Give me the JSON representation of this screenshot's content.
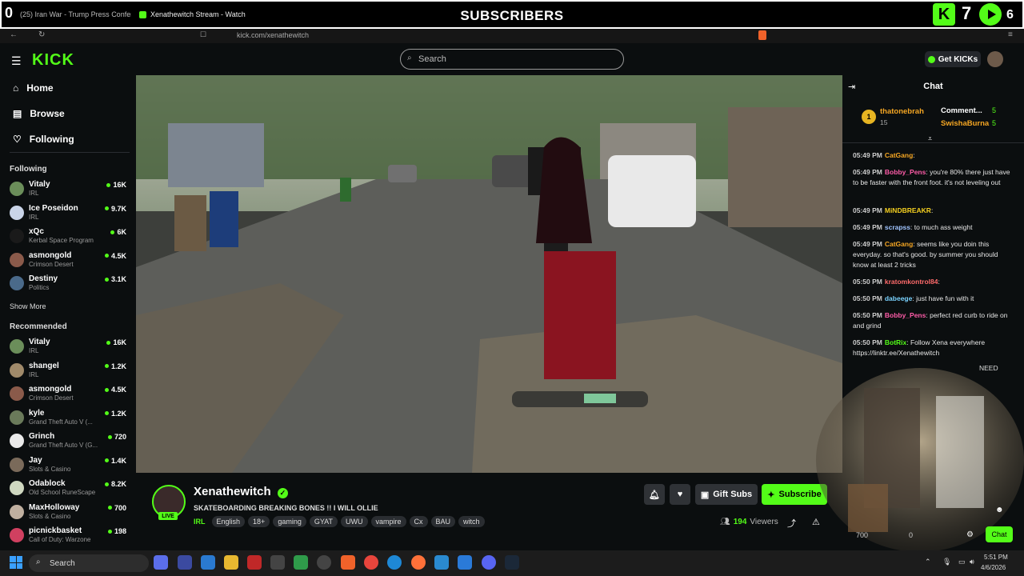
{
  "overlay": {
    "title": "SUBSCRIBERS",
    "left_count": "0",
    "right_count_a": "7",
    "right_count_b": "6"
  },
  "browser": {
    "tabs": [
      "(25) Iran War - Trump Press Conferen",
      "Xenathewitch Stream - Watch"
    ],
    "url": "kick.com/xenathewitch"
  },
  "header": {
    "logo": "KICK",
    "search_placeholder": "Search",
    "get_kicks_label": "Get KICKs"
  },
  "sidebar": {
    "nav": [
      "Home",
      "Browse",
      "Following"
    ],
    "following_title": "Following",
    "following": [
      {
        "name": "Vitaly",
        "category": "IRL",
        "viewers": "16K",
        "color": "#6b8e5a"
      },
      {
        "name": "Ice Poseidon",
        "category": "IRL",
        "viewers": "9.7K",
        "color": "#c9d4e8"
      },
      {
        "name": "xQc",
        "category": "Kerbal Space Program",
        "viewers": "6K",
        "color": "#1a1a1a"
      },
      {
        "name": "asmongold",
        "category": "Crimson Desert",
        "viewers": "4.5K",
        "color": "#8a5a4a"
      },
      {
        "name": "Destiny",
        "category": "Politics",
        "viewers": "3.1K",
        "color": "#4a6a8a"
      }
    ],
    "show_more": "Show More",
    "recommended_title": "Recommended",
    "recommended": [
      {
        "name": "Vitaly",
        "category": "IRL",
        "viewers": "16K",
        "color": "#6b8e5a"
      },
      {
        "name": "shangel",
        "category": "IRL",
        "viewers": "1.2K",
        "color": "#a08a6a"
      },
      {
        "name": "asmongold",
        "category": "Crimson Desert",
        "viewers": "4.5K",
        "color": "#8a5a4a"
      },
      {
        "name": "kyle",
        "category": "Grand Theft Auto V (...",
        "viewers": "1.2K",
        "color": "#6a7a5a"
      },
      {
        "name": "Grinch",
        "category": "Grand Theft Auto V (G...",
        "viewers": "720",
        "color": "#eaeaea"
      },
      {
        "name": "Jay",
        "category": "Slots & Casino",
        "viewers": "1.4K",
        "color": "#7a6a5a"
      },
      {
        "name": "Odablock",
        "category": "Old School RuneScape",
        "viewers": "8.2K",
        "color": "#cfd8c0"
      },
      {
        "name": "MaxHolloway",
        "category": "Slots & Casino",
        "viewers": "700",
        "color": "#c0b0a0"
      },
      {
        "name": "picnickbasket",
        "category": "Call of Duty: Warzone",
        "viewers": "198",
        "color": "#d04060"
      }
    ]
  },
  "stream": {
    "streamer": "Xenathewitch",
    "live_label": "LIVE",
    "title": "SKATEBOARDING BREAKING BONES !! I WILL OLLIE",
    "category": "IRL",
    "tags": [
      "English",
      "18+",
      "gaming",
      "GYAT",
      "UWU",
      "vampire",
      "Cx",
      "BAU",
      "witch"
    ],
    "gift_subs_label": "Gift Subs",
    "subscribe_label": "Subscribe",
    "viewers_count": "194",
    "viewers_label": "Viewers"
  },
  "chat": {
    "title": "Chat",
    "top_gifters": [
      {
        "rank": "1",
        "name": "thatonebrah",
        "count": "15"
      },
      {
        "name": "Comment...",
        "count": "5"
      },
      {
        "name": "SwishaBurna",
        "count": "5"
      }
    ],
    "messages": [
      {
        "time": "05:49 PM",
        "user": "CatGang",
        "color": "#f5a623",
        "text": ""
      },
      {
        "time": "05:49 PM",
        "user": "Bobby_Pens",
        "color": "#ff5ca8",
        "text": "you're 80% there just have to be faster with the front foot. it's not leveling out"
      },
      {
        "time": "05:49 PM",
        "user": "MiNDBREAKR",
        "color": "#f5d020",
        "text": ""
      },
      {
        "time": "05:49 PM",
        "user": "scrapss",
        "color": "#a0c4ff",
        "text": "to much ass weight"
      },
      {
        "time": "05:49 PM",
        "user": "CatGang",
        "color": "#f5a623",
        "text": "seems like you doin this everyday. so that's good. by summer you should know at least 2 tricks"
      },
      {
        "time": "05:50 PM",
        "user": "kratomkontrol84",
        "color": "#ff6b6b",
        "text": ""
      },
      {
        "time": "05:50 PM",
        "user": "dabeege",
        "color": "#7ad3ff",
        "text": "just have fun with it"
      },
      {
        "time": "05:50 PM",
        "user": "Bobby_Pens",
        "color": "#ff5ca8",
        "text": "perfect red curb to ride on and grind"
      },
      {
        "time": "05:50 PM",
        "user": "BotRix",
        "color": "#53fc18",
        "text": "Follow Xena everywhere https://linktr.ee/Xenathewitch"
      }
    ],
    "partial_text": "NEED",
    "send_label": "Chat",
    "overlay_count_a": "700",
    "overlay_count_b": "0"
  },
  "taskbar": {
    "search_label": "Search",
    "time": "5:51 PM",
    "date": "4/6/2026"
  }
}
